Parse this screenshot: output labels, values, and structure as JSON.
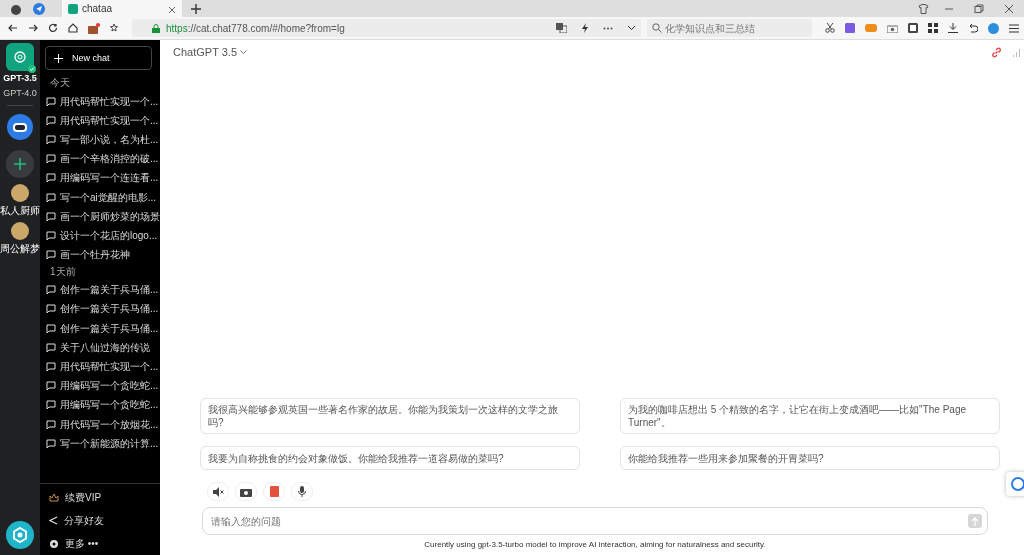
{
  "browser": {
    "tab_title": "chataa",
    "url_scheme": "https",
    "url_rest": "://cat.chat778.com/#/home?from=lg",
    "search_placeholder": "化学知识点和三总结"
  },
  "rail": {
    "models": [
      {
        "label": "GPT-3.5",
        "selected": true
      },
      {
        "label": "GPT-4.0",
        "selected": false
      }
    ],
    "agents": [
      "私人厨师",
      "周公解梦"
    ]
  },
  "sidebar": {
    "new_chat": "New chat",
    "groups": [
      {
        "heading": "今天",
        "items": [
          "用代码帮忙实现一个...",
          "用代码帮忙实现一个...",
          "写一部小说，名为杜...",
          "画一个辛格消控的破...",
          "用编码写一个连连看...",
          "写一个ai觉醒的电影...",
          "画一个厨师炒菜的场景",
          "设计一个花店的logo...",
          "画一个牡丹花神"
        ]
      },
      {
        "heading": "1天前",
        "items": [
          "创作一篇关于兵马俑...",
          "创作一篇关于兵马俑...",
          "创作一篇关于兵马俑...",
          "关于八仙过海的传说",
          "用代码帮忙实现一个...",
          "用编码写一个贪吃蛇...",
          "用编码写一个贪吃蛇...",
          "用代码写一个放烟花...",
          "写一个新能源的计算..."
        ]
      }
    ],
    "footer": [
      {
        "kind": "vip",
        "label": "续费VIP"
      },
      {
        "kind": "share",
        "label": "分享好友"
      },
      {
        "kind": "more",
        "label": "更多 •••"
      }
    ]
  },
  "main": {
    "model_title": "ChatGPT 3.5",
    "suggestions": [
      "我很高兴能够参观英国一些著名作家的故居。你能为我策划一次这样的文学之旅吗?",
      "为我的咖啡店想出 5 个精致的名字，让它在街上变成酒吧——比如\"The Page Turner\"。",
      "我要为自称挑食的约会对象做饭。你能给我推荐一道容易做的菜吗?",
      "你能给我推荐一些用来参加聚餐的开胃菜吗?"
    ],
    "input_placeholder": "请输入您的问题",
    "footnote": "Curently using gpt-3.5-turbo model to improve AI interaction, aiming for naturalness and security."
  }
}
